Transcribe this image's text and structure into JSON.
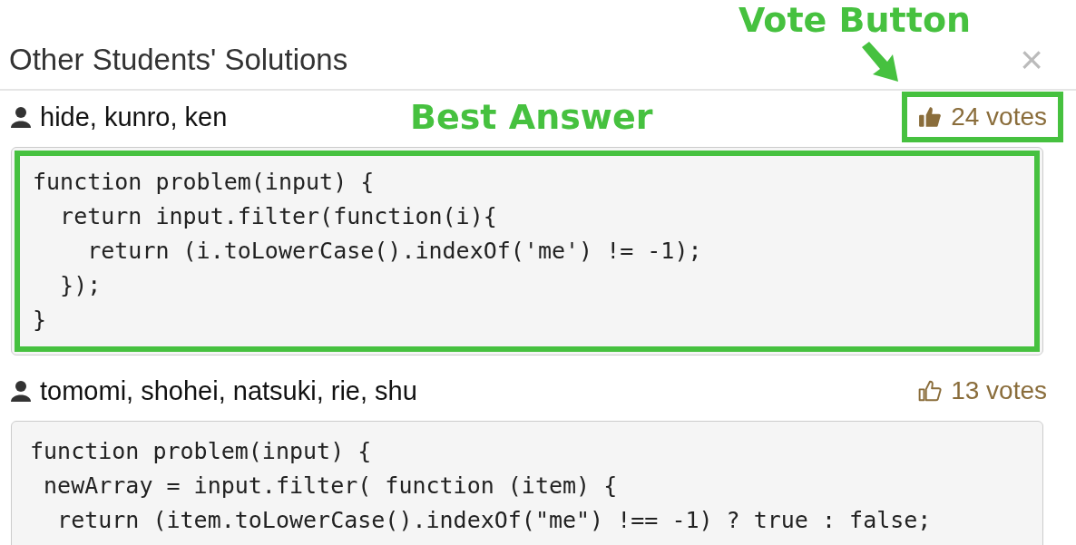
{
  "title": "Other Students' Solutions",
  "close": "×",
  "annotations": {
    "vote_label": "Vote Button",
    "best_label": "Best Answer"
  },
  "solutions": [
    {
      "authors": "hide, kunro, ken",
      "votes": "24 votes",
      "voted": true,
      "highlighted": true,
      "code": [
        "function problem(input) {",
        "  return input.filter(function(i){",
        "    return (i.toLowerCase().indexOf('me') != -1);",
        "  });",
        "}"
      ]
    },
    {
      "authors": "tomomi, shohei, natsuki, rie, shu",
      "votes": "13 votes",
      "voted": false,
      "highlighted": false,
      "code": [
        "function problem(input) {",
        " newArray = input.filter( function (item) {",
        "  return (item.toLowerCase().indexOf(\"me\") !== -1) ? true : false;"
      ]
    }
  ]
}
